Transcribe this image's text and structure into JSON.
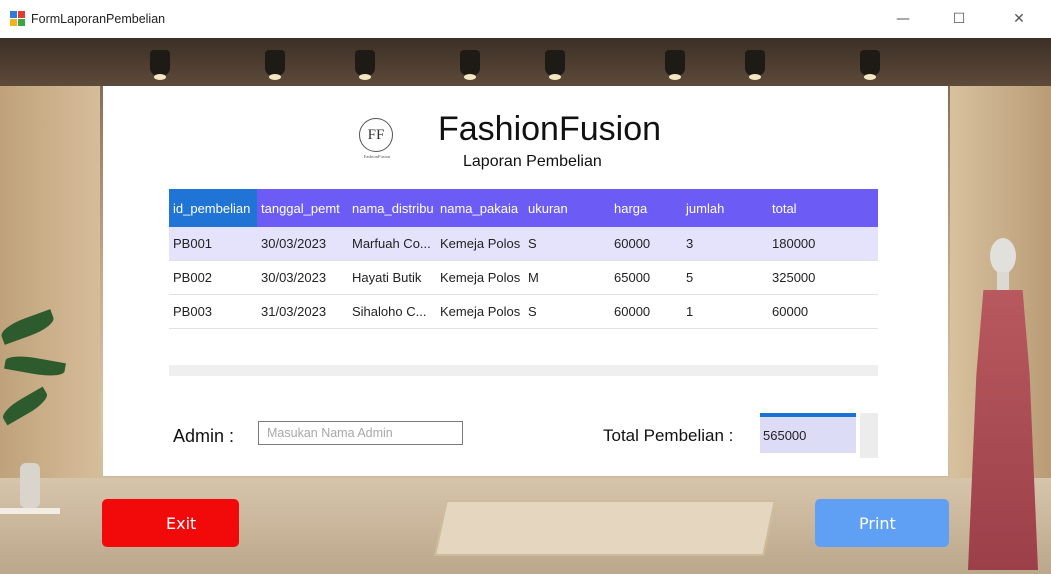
{
  "window": {
    "title": "FormLaporanPembelian",
    "minimize_glyph": "—",
    "maximize_glyph": "☐",
    "close_glyph": "✕"
  },
  "header": {
    "logo_letters": "FF",
    "logo_caption": "FashionFusion",
    "brand": "FashionFusion",
    "subtitle": "Laporan Pembelian"
  },
  "grid": {
    "columns": [
      "id_pembelian",
      "tanggal_pemt",
      "nama_distribu",
      "nama_pakaia",
      "ukuran",
      "harga",
      "jumlah",
      "total"
    ],
    "rows": [
      [
        "PB001",
        "30/03/2023",
        "Marfuah Co...",
        "Kemeja Polos",
        "S",
        "60000",
        "3",
        "180000"
      ],
      [
        "PB002",
        "30/03/2023",
        "Hayati Butik",
        "Kemeja Polos",
        "M",
        "65000",
        "5",
        "325000"
      ],
      [
        "PB003",
        "31/03/2023",
        "Sihaloho C...",
        "Kemeja Polos",
        "S",
        "60000",
        "1",
        "60000"
      ]
    ]
  },
  "footer": {
    "admin_label": "Admin :",
    "admin_placeholder": "Masukan Nama Admin",
    "total_label": "Total Pembelian :",
    "total_value": "565000"
  },
  "buttons": {
    "exit": "Exit",
    "print": "Print"
  },
  "colors": {
    "header_bg": "#6c5bf4",
    "header_first_bg": "#1f74d6",
    "selected_row": "#e4e3fb",
    "exit_button": "#f20a0a",
    "print_button": "#5fa0f5"
  },
  "icons": {
    "app": "form-app-icon",
    "logo": "fashionfusion-logo"
  }
}
